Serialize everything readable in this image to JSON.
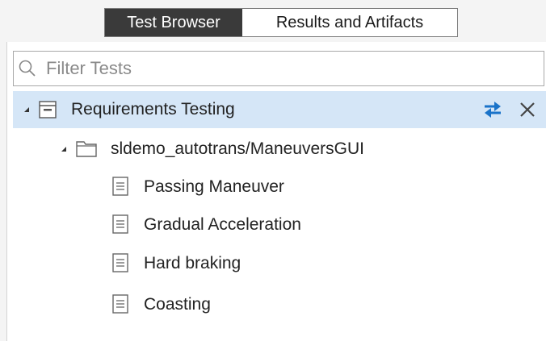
{
  "tabs": [
    {
      "label": "Test Browser",
      "active": true
    },
    {
      "label": "Results and Artifacts",
      "active": false
    }
  ],
  "filter": {
    "placeholder": "Filter Tests",
    "value": ""
  },
  "tree": {
    "root": {
      "label": "Requirements Testing",
      "icon": "test-file-icon",
      "expanded": true,
      "selected": true
    },
    "suite": {
      "label": "sldemo_autotrans/ManeuversGUI",
      "icon": "folder-icon",
      "expanded": true
    },
    "cases": [
      {
        "label": "Passing Maneuver",
        "icon": "document-icon"
      },
      {
        "label": "Gradual Acceleration",
        "icon": "document-icon"
      },
      {
        "label": "Hard braking",
        "icon": "document-icon"
      },
      {
        "label": "Coasting",
        "icon": "document-icon"
      }
    ]
  },
  "colors": {
    "selection": "#d5e6f7",
    "accent": "#1a73c9",
    "tab_active_bg": "#3a3a3a"
  }
}
